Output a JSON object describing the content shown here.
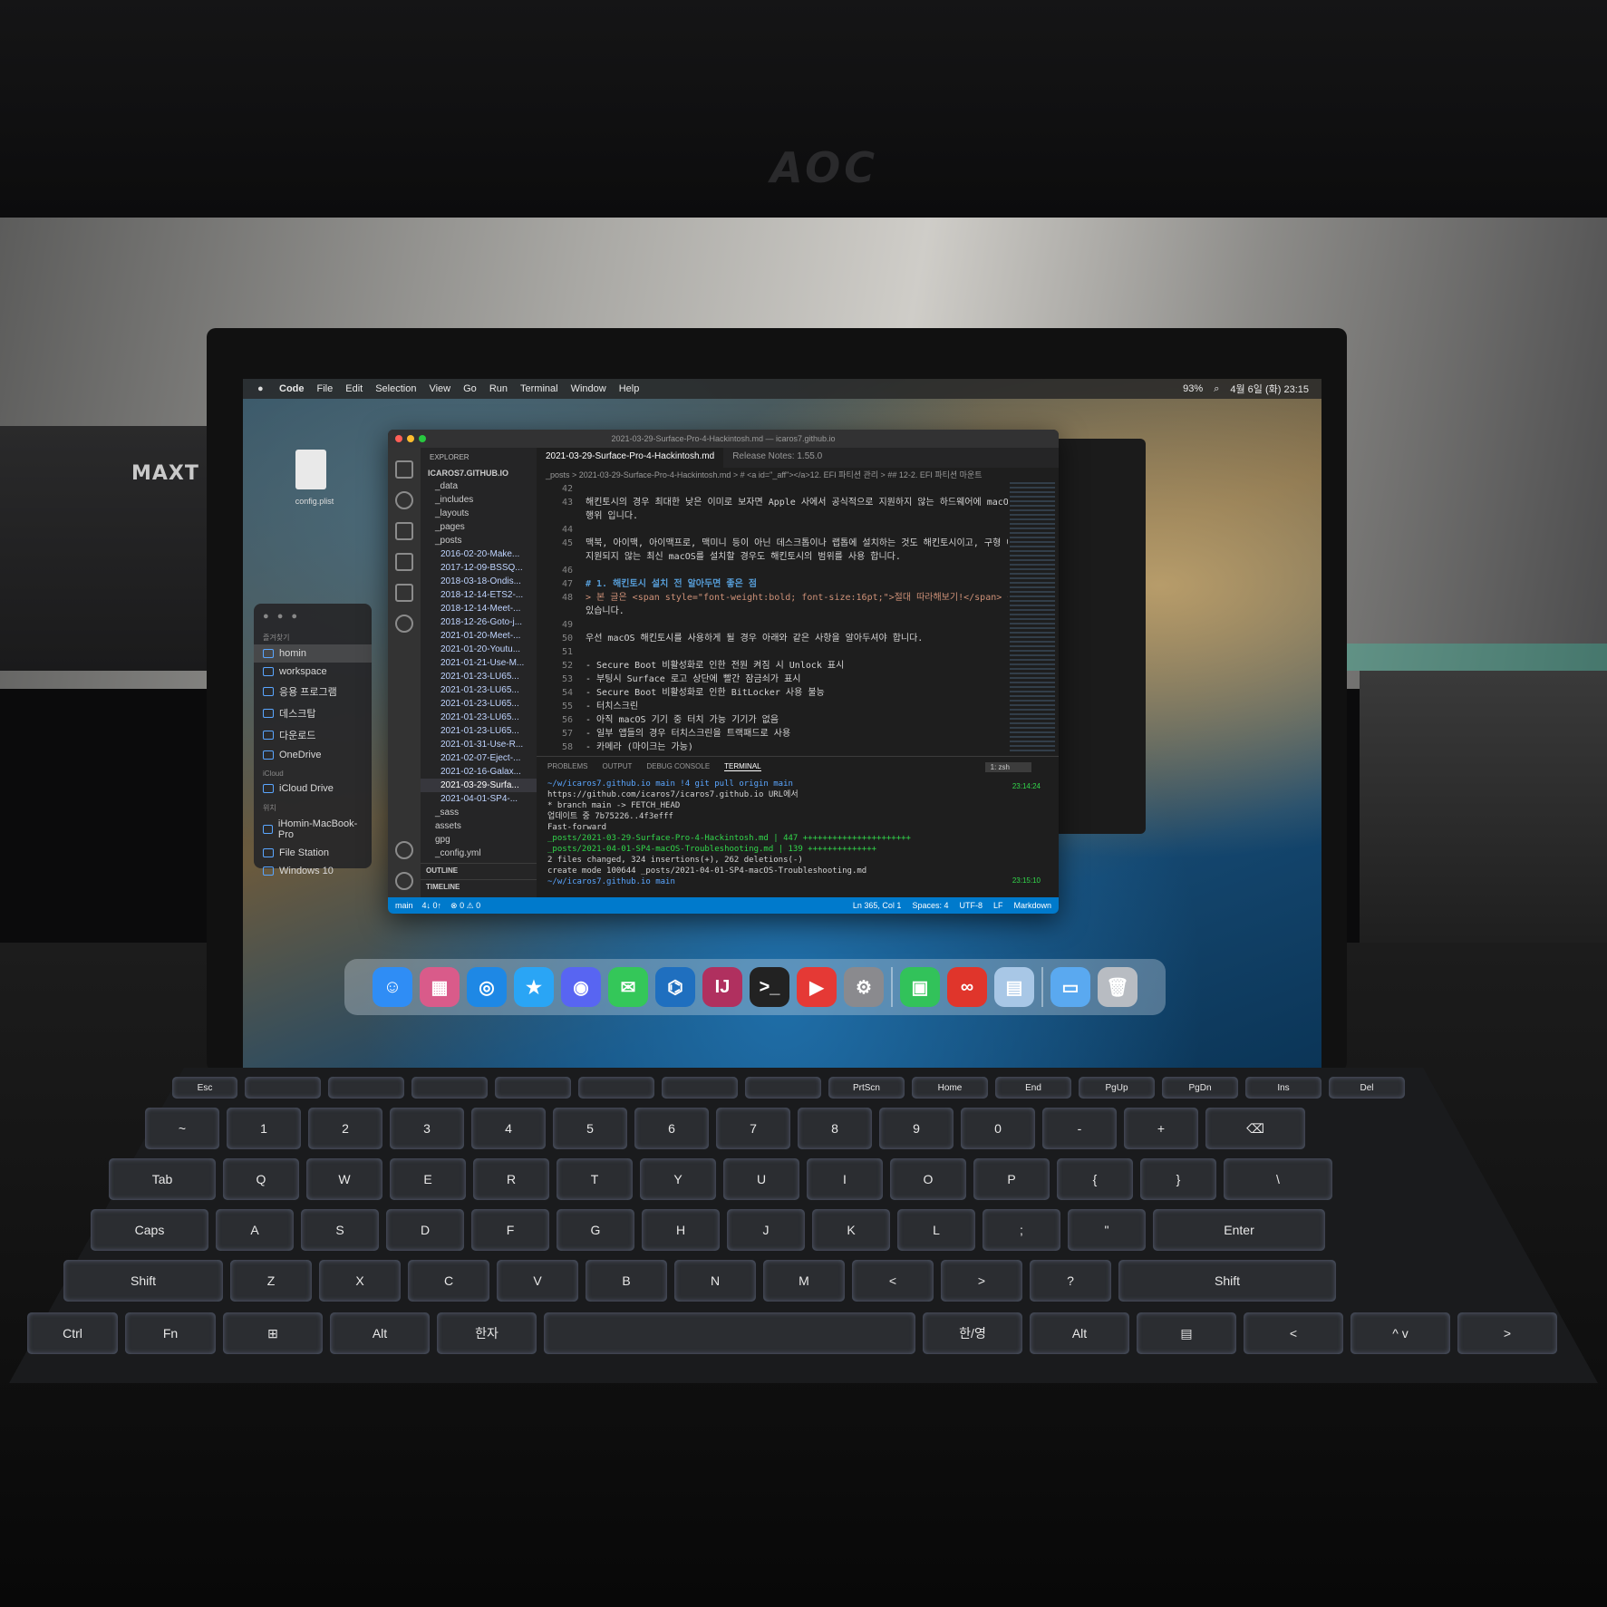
{
  "scene": {
    "monitor_brand": "AOC",
    "box_brand": "MAXT"
  },
  "menubar": {
    "app": "Code",
    "items": [
      "File",
      "Edit",
      "Selection",
      "View",
      "Go",
      "Run",
      "Terminal",
      "Window",
      "Help"
    ],
    "clock": "4월 6일 (화) 23:15",
    "battery": "93%"
  },
  "desktop": {
    "file_label": "config.plist"
  },
  "finder": {
    "favorites_label": "즐겨찾기",
    "favorites": [
      "homin",
      "workspace",
      "응용 프로그램",
      "데스크탑",
      "다운로드",
      "OneDrive"
    ],
    "icloud_label": "iCloud",
    "icloud": [
      "iCloud Drive"
    ],
    "locations_label": "위치",
    "locations": [
      "iHomin-MacBook-Pro",
      "File Station",
      "Windows 10"
    ]
  },
  "vscode": {
    "window_title": "2021-03-29-Surface-Pro-4-Hackintosh.md — icaros7.github.io",
    "explorer_header": "EXPLORER",
    "root": "ICAROS7.GITHUB.IO",
    "folders_top": [
      "_data",
      "_includes",
      "_layouts",
      "_pages",
      "_posts"
    ],
    "posts": [
      "2016-02-20-Make...",
      "2017-12-09-BSSQ...",
      "2018-03-18-Ondis...",
      "2018-12-14-ETS2-...",
      "2018-12-14-Meet-...",
      "2018-12-26-Goto-j...",
      "2021-01-20-Meet-...",
      "2021-01-20-Youtu...",
      "2021-01-21-Use-M...",
      "2021-01-23-LU65...",
      "2021-01-23-LU65...",
      "2021-01-23-LU65...",
      "2021-01-23-LU65...",
      "2021-01-23-LU65...",
      "2021-01-31-Use-R...",
      "2021-02-07-Eject-...",
      "2021-02-16-Galax...",
      "2021-03-29-Surfa...",
      "2021-04-01-SP4-..."
    ],
    "folders_bottom": [
      "_sass",
      "assets",
      "gpg",
      "_config.yml"
    ],
    "outline": "OUTLINE",
    "timeline": "TIMELINE",
    "tabs": [
      "2021-03-29-Surface-Pro-4-Hackintosh.md",
      "Release Notes: 1.55.0"
    ],
    "breadcrumb": "_posts > 2021-03-29-Surface-Pro-4-Hackintosh.md > # <a id=\"_aff\"></a>12. EFI 파티션 관리 > ## 12-2. EFI 파티션 마운트",
    "code_lines": [
      {
        "n": "42",
        "t": "",
        "c": ""
      },
      {
        "n": "43",
        "t": "해킨토시의 경우 최대한 낮은 이미로 보자면 Apple 사에서 공식적으로 지원하지 않는 하드웨어에 macOS를 설치하는",
        "c": ""
      },
      {
        "n": "",
        "t": "행위 입니다.",
        "c": ""
      },
      {
        "n": "44",
        "t": "",
        "c": ""
      },
      {
        "n": "45",
        "t": "맥북, 아이맥, 아이맥프로, 맥미니 등이 아닌 데스크톱이나 랩톱에 설치하는 것도 해킨토시이고, 구형 애플 기기에",
        "c": ""
      },
      {
        "n": "",
        "t": "지원되지 않는 최신 macOS를 설치할 경우도 해킨토시의 범위를 사용 합니다.",
        "c": ""
      },
      {
        "n": "46",
        "t": "",
        "c": ""
      },
      {
        "n": "47",
        "t": "# 1. 해킨토시 설치 전 알아두면 좋은 점",
        "c": "hd"
      },
      {
        "n": "48",
        "t": "> 본 글은 <span style=\"font-weight:bold; font-size:16pt;\">절대 따라해보기!</span> 를 추구하고",
        "c": "bl"
      },
      {
        "n": "",
        "t": "있습니다.",
        "c": ""
      },
      {
        "n": "49",
        "t": "",
        "c": ""
      },
      {
        "n": "50",
        "t": "우선 macOS 해킨토시를 사용하게 될 경우 아래와 같은 사항을 알아두셔야 합니다.",
        "c": ""
      },
      {
        "n": "51",
        "t": "",
        "c": ""
      },
      {
        "n": "52",
        "t": "- Secure Boot 비활성화로 인한 전원 켜짐 시 Unlock 표시",
        "c": ""
      },
      {
        "n": "53",
        "t": "    - 부팅시 Surface 로고 상단에 빨간 잠금쇠가 표시",
        "c": ""
      },
      {
        "n": "54",
        "t": "- Secure Boot 비활성화로 인한 BitLocker 사용 불능",
        "c": ""
      },
      {
        "n": "55",
        "t": "- 터치스크린",
        "c": ""
      },
      {
        "n": "56",
        "t": "    - 아직 macOS 기기 중 터치 가능 기기가 없음",
        "c": ""
      },
      {
        "n": "57",
        "t": "    - 일부 앱들의 경우 터치스크린을 트랙패드로 사용",
        "c": ""
      },
      {
        "n": "58",
        "t": "- 카메라 (마이크는 가능)",
        "c": ""
      },
      {
        "n": "59",
        "t": "- Wi-Fi / 블루투스",
        "c": ""
      },
      {
        "n": "60",
        "t": "    - Surface 제품군 대부분이 Marvell 컨트롤러 사용",
        "c": ""
      }
    ],
    "panel_tabs": [
      "PROBLEMS",
      "OUTPUT",
      "DEBUG CONSOLE",
      "TERMINAL"
    ],
    "terminal_select": "1: zsh",
    "terminal_lines": [
      {
        "t": "~/w/icaros7.github.io  main !4  git pull origin main",
        "c": "pr"
      },
      {
        "t": "https://github.com/icaros7/icaros7.github.io URL에서",
        "c": ""
      },
      {
        "t": " * branch            main       -> FETCH_HEAD",
        "c": ""
      },
      {
        "t": "업데이트 중 7b75226..4f3efff",
        "c": ""
      },
      {
        "t": "Fast-forward",
        "c": ""
      },
      {
        "t": " _posts/2021-03-29-Surface-Pro-4-Hackintosh.md  | 447 ++++++++++++++++++++++",
        "c": "plus"
      },
      {
        "t": " _posts/2021-04-01-SP4-macOS-Troubleshooting.md | 139 ++++++++++++++",
        "c": "plus"
      },
      {
        "t": " 2 files changed, 324 insertions(+), 262 deletions(-)",
        "c": ""
      },
      {
        "t": " create mode 100644 _posts/2021-04-01-SP4-macOS-Troubleshooting.md",
        "c": ""
      },
      {
        "t": "~/w/icaros7.github.io  main",
        "c": "pr"
      }
    ],
    "times": [
      "23:14:24",
      "23:15:10"
    ],
    "status": {
      "branch": "main",
      "sync": "4↓ 0↑",
      "problems": "⊗ 0 ⚠ 0",
      "position": "Ln 365, Col 1",
      "spaces": "Spaces: 4",
      "encoding": "UTF-8",
      "eol": "LF",
      "language": "Markdown"
    }
  },
  "dock": [
    {
      "name": "finder",
      "color": "#2f8df5",
      "glyph": "☺"
    },
    {
      "name": "launchpad",
      "color": "#d95b8a",
      "glyph": "▦"
    },
    {
      "name": "safari",
      "color": "#1e88e5",
      "glyph": "◎"
    },
    {
      "name": "app-store",
      "color": "#2aa5f5",
      "glyph": "★"
    },
    {
      "name": "discord",
      "color": "#5865f2",
      "glyph": "◉"
    },
    {
      "name": "messages",
      "color": "#34c759",
      "glyph": "✉"
    },
    {
      "name": "vscode",
      "color": "#1f6fbf",
      "glyph": "⌬"
    },
    {
      "name": "intellij",
      "color": "#b0305f",
      "glyph": "IJ"
    },
    {
      "name": "terminal",
      "color": "#222222",
      "glyph": ">_"
    },
    {
      "name": "youtube-music",
      "color": "#e53935",
      "glyph": "▶"
    },
    {
      "name": "system-preferences",
      "color": "#8a8a8e",
      "glyph": "⚙"
    },
    {
      "name": "facetime",
      "color": "#32c25a",
      "glyph": "▣"
    },
    {
      "name": "authy",
      "color": "#e0352b",
      "glyph": "∞"
    },
    {
      "name": "preview",
      "color": "#a8c7e6",
      "glyph": "▤"
    },
    {
      "name": "downloads-folder",
      "color": "#5aa9f0",
      "glyph": "▭"
    },
    {
      "name": "trash",
      "color": "#b8bcc2",
      "glyph": "🗑"
    }
  ],
  "keyboard": {
    "fn_row": [
      "Esc",
      "",
      "",
      "",
      "",
      "",
      "",
      "",
      "PrtScn",
      "Home",
      "End",
      "PgUp",
      "PgDn",
      "Ins",
      "Del"
    ],
    "num_row": [
      "~",
      "1",
      "2",
      "3",
      "4",
      "5",
      "6",
      "7",
      "8",
      "9",
      "0",
      "-",
      "+",
      "⌫"
    ],
    "top_row": [
      "Tab",
      "Q",
      "W",
      "E",
      "R",
      "T",
      "Y",
      "U",
      "I",
      "O",
      "P",
      "{",
      "}",
      "\\"
    ],
    "home_row": [
      "Caps",
      "A",
      "S",
      "D",
      "F",
      "G",
      "H",
      "J",
      "K",
      "L",
      ";",
      "\"",
      "Enter"
    ],
    "bottom_row": [
      "Shift",
      "Z",
      "X",
      "C",
      "V",
      "B",
      "N",
      "M",
      "<",
      ">",
      "?",
      "Shift"
    ],
    "space_row": [
      "Ctrl",
      "Fn",
      "⊞",
      "Alt",
      "한자",
      "",
      "한/영",
      "Alt",
      "▤",
      "<",
      "^ v",
      ">"
    ]
  }
}
